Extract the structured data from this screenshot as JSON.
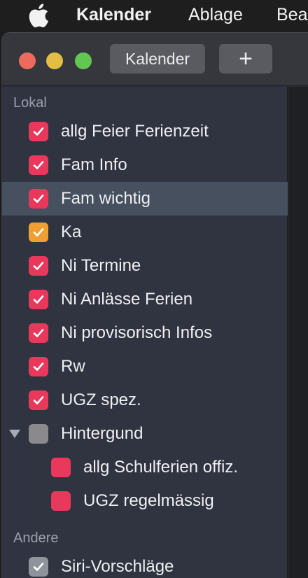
{
  "menubar": {
    "apple_icon": "apple-logo-icon",
    "app_name": "Kalender",
    "items": [
      "Ablage",
      "Bea"
    ]
  },
  "toolbar": {
    "kalender_label": "Kalender",
    "add_label": "+"
  },
  "sidebar": {
    "sections": [
      {
        "header": "Lokal",
        "items": [
          {
            "label": "allg Feier Ferienzeit",
            "checked": true,
            "color": "#e8385c"
          },
          {
            "label": "Fam Info",
            "checked": true,
            "color": "#e8385c"
          },
          {
            "label": "Fam wichtig",
            "checked": true,
            "color": "#e8385c",
            "selected": true
          },
          {
            "label": "Ka",
            "checked": true,
            "color": "#f0a030"
          },
          {
            "label": "Ni Termine",
            "checked": true,
            "color": "#e8385c"
          },
          {
            "label": "Ni Anlässe Ferien",
            "checked": true,
            "color": "#e8385c"
          },
          {
            "label": "Ni provisorisch Infos",
            "checked": true,
            "color": "#e8385c"
          },
          {
            "label": "Rw",
            "checked": true,
            "color": "#e8385c"
          },
          {
            "label": "UGZ spez.",
            "checked": true,
            "color": "#e8385c"
          },
          {
            "label": "Hintergund",
            "checked": false,
            "color": "#8a8a8c",
            "expanded": true,
            "children": [
              {
                "label": "allg Schulferien offiz.",
                "checked": false,
                "color": "#e8385c"
              },
              {
                "label": "UGZ regelmässig",
                "checked": false,
                "color": "#e8385c"
              }
            ]
          }
        ]
      },
      {
        "header": "Andere",
        "items": [
          {
            "label": "Siri-Vorschläge",
            "checked": true,
            "color": "#8e939c"
          }
        ]
      }
    ]
  }
}
